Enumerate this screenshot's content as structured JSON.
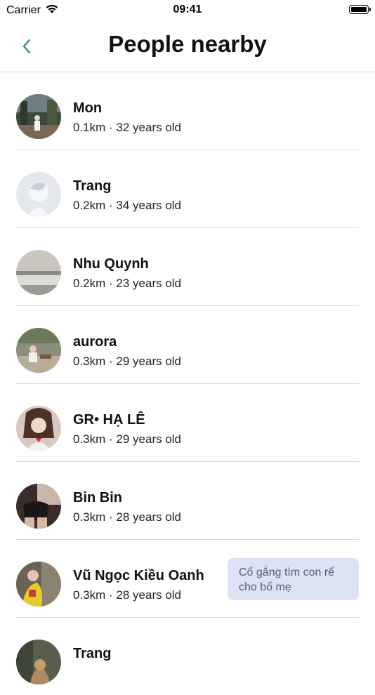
{
  "status_bar": {
    "carrier": "Carrier",
    "time": "09:41"
  },
  "nav": {
    "title": "People nearby"
  },
  "people": [
    {
      "name": "Mon",
      "meta": "0.1km · 32 years old"
    },
    {
      "name": "Trang",
      "meta": "0.2km · 34 years old"
    },
    {
      "name": "Nhu Quynh",
      "meta": "0.2km · 23 years old"
    },
    {
      "name": "aurora",
      "meta": "0.3km · 29 years old"
    },
    {
      "name": "GR• HẠ LÊ",
      "meta": "0.3km · 29 years old"
    },
    {
      "name": "Bin Bin",
      "meta": "0.3km · 28 years old"
    },
    {
      "name": "Vũ Ngọc Kiều Oanh",
      "meta": "0.3km · 28 years old",
      "note": "Cố gắng tìm con rể cho bố mẹ"
    },
    {
      "name": "Trang",
      "meta": ""
    }
  ],
  "colors": {
    "accent": "#2a8c82",
    "note_bg": "#dde3f2",
    "divider": "#d9d9d9"
  },
  "icons": {
    "back": "chevron-left-icon",
    "wifi": "wifi-icon",
    "battery": "battery-icon"
  }
}
